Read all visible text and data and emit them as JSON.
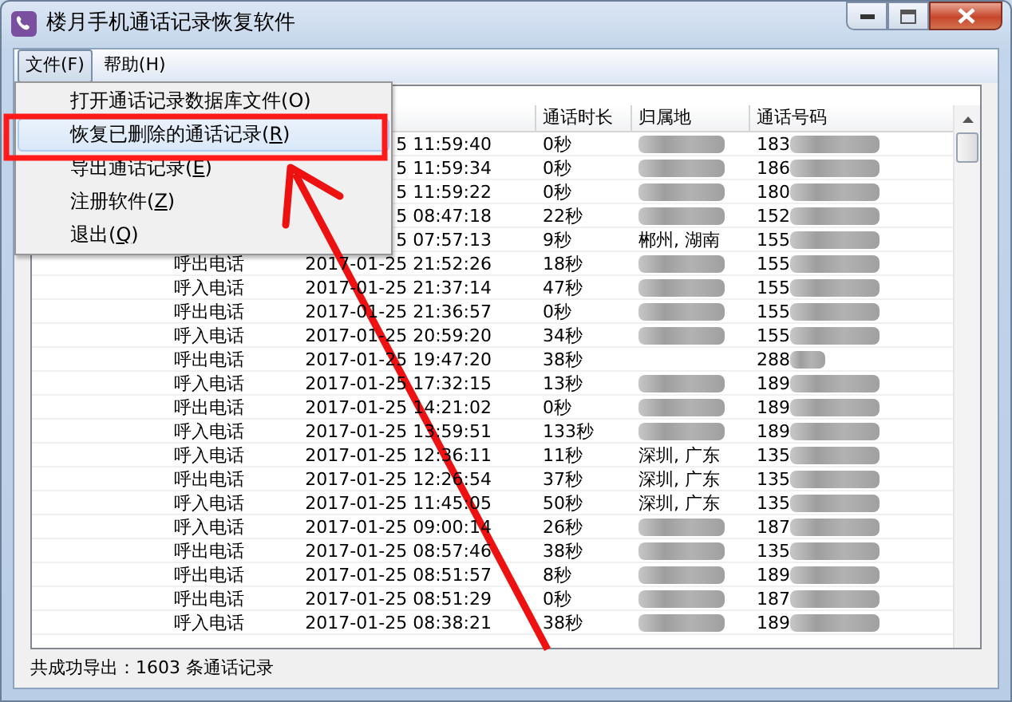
{
  "window": {
    "title": "楼月手机通话记录恢复软件"
  },
  "menubar": [
    {
      "label": "文件(F)",
      "selected": true
    },
    {
      "label": "帮助(H)",
      "selected": false
    }
  ],
  "menu": [
    {
      "before": "打开通话记录数据库文件(",
      "key": "O",
      "after": ")",
      "underline": false,
      "selected": false
    },
    {
      "before": "恢复已删除的通话记录(",
      "key": "R",
      "after": ")",
      "underline": true,
      "selected": true
    },
    {
      "before": "导出通话记录(",
      "key": "E",
      "after": ")",
      "underline": true,
      "selected": false
    },
    {
      "before": "注册软件(",
      "key": "Z",
      "after": ")",
      "underline": true,
      "selected": false
    },
    {
      "before": "退出(",
      "key": "Q",
      "after": ")",
      "underline": true,
      "selected": false
    }
  ],
  "table": {
    "columns": [
      "通话时长",
      "归属地",
      "通话号码"
    ],
    "rows": [
      {
        "time": "5 11:59:40",
        "duration": "0秒",
        "location_blurred": true,
        "number": "183"
      },
      {
        "time": "5 11:59:34",
        "duration": "0秒",
        "location_blurred": true,
        "number": "186"
      },
      {
        "time": "5 11:59:22",
        "duration": "0秒",
        "location_blurred": true,
        "number": "180"
      },
      {
        "time": "5 08:47:18",
        "duration": "22秒",
        "location_blurred": true,
        "number": "152"
      },
      {
        "time": "5 07:57:13",
        "duration": "9秒",
        "location": "郴州, 湖南",
        "location_blurred": false,
        "number": "155"
      },
      {
        "type": "呼出电话",
        "time": "2017-01-25 21:52:26",
        "duration": "18秒",
        "location_blurred": true,
        "number": "155"
      },
      {
        "type": "呼入电话",
        "time": "2017-01-25 21:37:14",
        "duration": "47秒",
        "location_blurred": true,
        "number": "155"
      },
      {
        "type": "呼出电话",
        "time": "2017-01-25 21:36:57",
        "duration": "0秒",
        "location_blurred": true,
        "number": "155"
      },
      {
        "type": "呼入电话",
        "time": "2017-01-25 20:59:20",
        "duration": "34秒",
        "location_blurred": true,
        "number": "155"
      },
      {
        "type": "呼出电话",
        "time": "2017-01-25 19:47:20",
        "duration": "38秒",
        "location_blurred": false,
        "number": "288"
      },
      {
        "type": "呼入电话",
        "time": "2017-01-25 17:32:15",
        "duration": "13秒",
        "location_blurred": true,
        "number": "189"
      },
      {
        "type": "呼出电话",
        "time": "2017-01-25 14:21:02",
        "duration": "0秒",
        "location_blurred": true,
        "number": "189"
      },
      {
        "type": "呼入电话",
        "time": "2017-01-25 13:59:51",
        "duration": "133秒",
        "location_blurred": true,
        "number": "189"
      },
      {
        "type": "呼入电话",
        "time": "2017-01-25 12:36:11",
        "duration": "11秒",
        "location": "深圳, 广东",
        "location_blurred": false,
        "number": "135"
      },
      {
        "type": "呼出电话",
        "time": "2017-01-25 12:26:54",
        "duration": "37秒",
        "location": "深圳, 广东",
        "location_blurred": false,
        "number": "135"
      },
      {
        "type": "呼入电话",
        "time": "2017-01-25 11:45:05",
        "duration": "50秒",
        "location": "深圳, 广东",
        "location_blurred": false,
        "number": "135"
      },
      {
        "type": "呼入电话",
        "time": "2017-01-25 09:00:14",
        "duration": "26秒",
        "location_blurred": true,
        "number": "187"
      },
      {
        "type": "呼出电话",
        "time": "2017-01-25 08:57:46",
        "duration": "38秒",
        "location_blurred": true,
        "number": "135"
      },
      {
        "type": "呼出电话",
        "time": "2017-01-25 08:51:57",
        "duration": "8秒",
        "location_blurred": true,
        "number": "189"
      },
      {
        "type": "呼出电话",
        "time": "2017-01-25 08:51:29",
        "duration": "0秒",
        "location_blurred": true,
        "number": "187"
      },
      {
        "type": "呼入电话",
        "time": "2017-01-25 08:38:21",
        "duration": "38秒",
        "location_blurred": true,
        "number": "189"
      }
    ]
  },
  "status_bar": "共成功导出：1603 条通话记录"
}
